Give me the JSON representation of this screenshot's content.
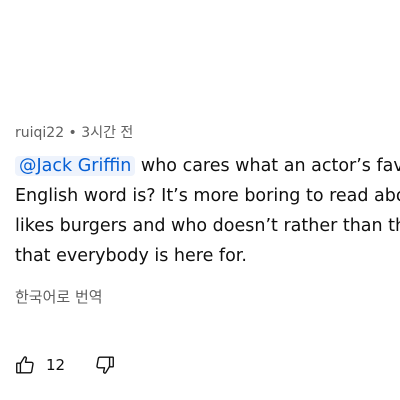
{
  "comment": {
    "author": "ruiqi22",
    "separator": " • ",
    "timestamp": "3시간 전",
    "mention": "@Jack Griffin",
    "lines": [
      " who cares what an actor’s fav",
      "English word is? It’s more boring to read abo",
      "likes burgers and who doesn’t rather than th",
      "that everybody is here for."
    ],
    "translate_label": "한국어로 번역",
    "like_count": "12",
    "icons": {
      "like": "thumbs-up-icon",
      "dislike": "thumbs-down-icon"
    },
    "colors": {
      "mention": "#065fd4",
      "meta": "#606060",
      "text": "#0f0f0f"
    }
  }
}
